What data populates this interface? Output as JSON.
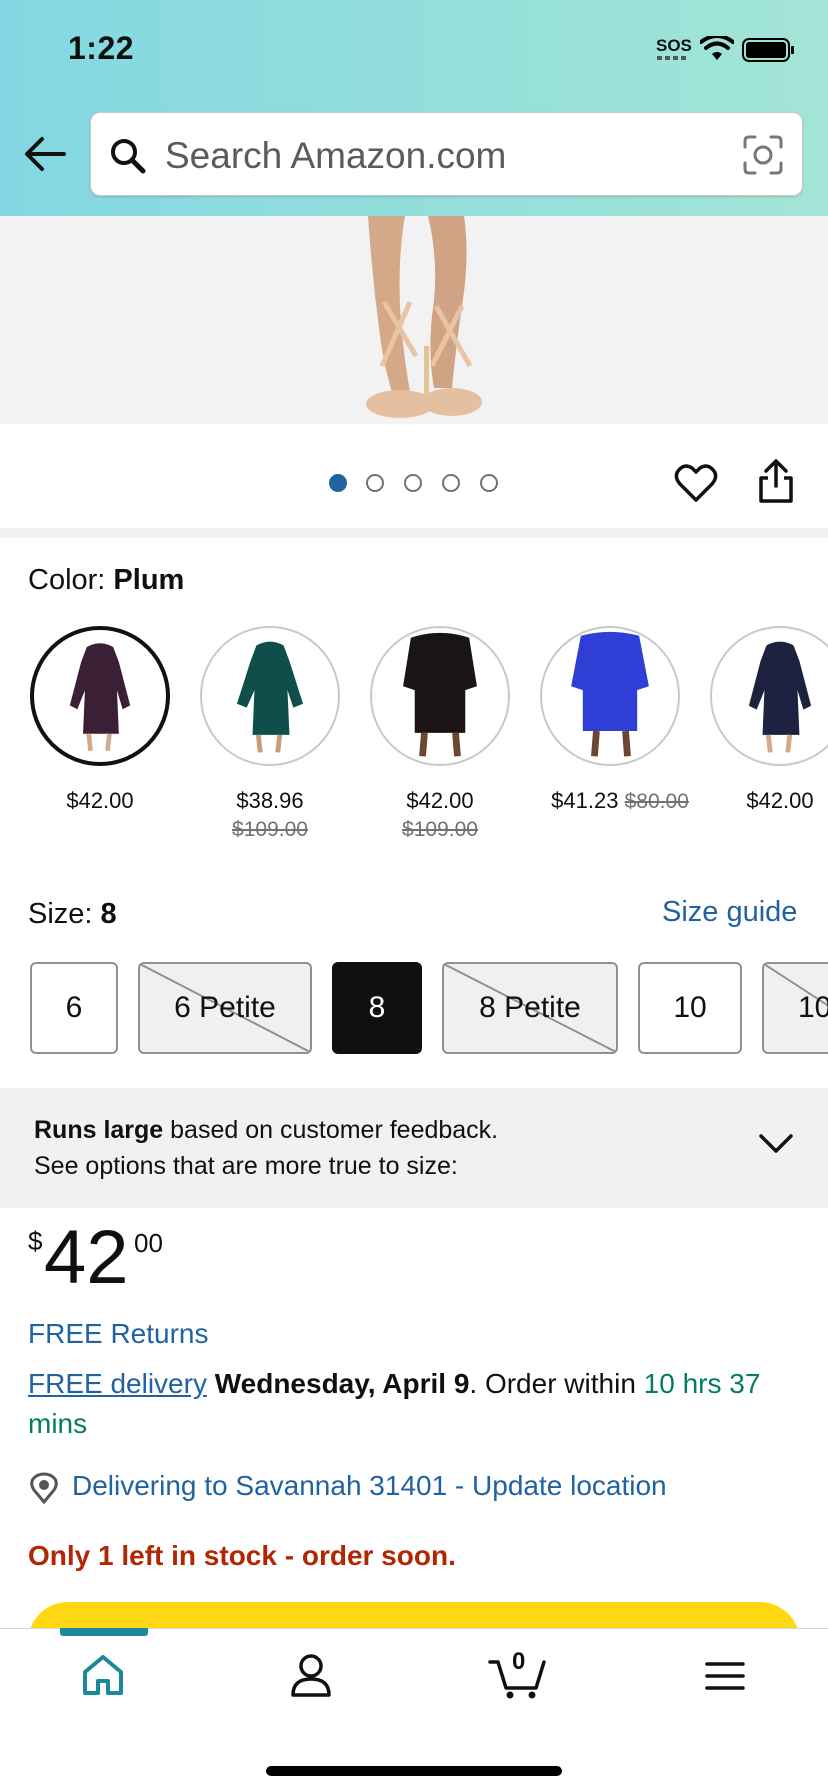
{
  "status": {
    "time": "1:22",
    "sos": "SOS"
  },
  "search": {
    "placeholder": "Search Amazon.com"
  },
  "gallery": {
    "dots": 5,
    "active_index": 0
  },
  "color": {
    "label": "Color:",
    "selected": "Plum",
    "options": [
      {
        "name": "Plum",
        "price": "$42.00",
        "list_price": "",
        "dress_color": "#3b1f35"
      },
      {
        "name": "Teal",
        "price": "$38.96",
        "list_price": "$109.00",
        "dress_color": "#0f4e4b"
      },
      {
        "name": "Black",
        "price": "$42.00",
        "list_price": "$109.00",
        "dress_color": "#1a1414"
      },
      {
        "name": "Blue",
        "price": "$41.23",
        "list_price": "$80.00",
        "dress_color": "#2f3fd6"
      },
      {
        "name": "Navy",
        "price": "$42.00",
        "list_price": "",
        "dress_color": "#1c2240"
      }
    ]
  },
  "size": {
    "label": "Size:",
    "selected": "8",
    "guide_label": "Size guide",
    "options": [
      {
        "label": "6",
        "state": "available"
      },
      {
        "label": "6 Petite",
        "state": "unavailable"
      },
      {
        "label": "8",
        "state": "selected"
      },
      {
        "label": "8 Petite",
        "state": "unavailable"
      },
      {
        "label": "10",
        "state": "available"
      },
      {
        "label": "10",
        "state": "unavailable"
      }
    ]
  },
  "fit": {
    "bold": "Runs large",
    "text": " based on customer feedback.",
    "line2": "See options that are more true to size:"
  },
  "price": {
    "symbol": "$",
    "whole": "42",
    "fraction": "00"
  },
  "returns": "FREE Returns",
  "delivery": {
    "link": "FREE delivery",
    "date": "Wednesday, April 9",
    "mid": ". Order within ",
    "countdown": "10 hrs 37 mins"
  },
  "location": "Delivering to Savannah 31401 - Update location",
  "stock": "Only 1 left in stock - order soon.",
  "cart": {
    "count": "0"
  },
  "colors": {
    "link": "#2162a1",
    "deal": "#067d62",
    "alert": "#b12704",
    "buy_button": "#ffd814",
    "nav_active": "#1a8a9b"
  }
}
